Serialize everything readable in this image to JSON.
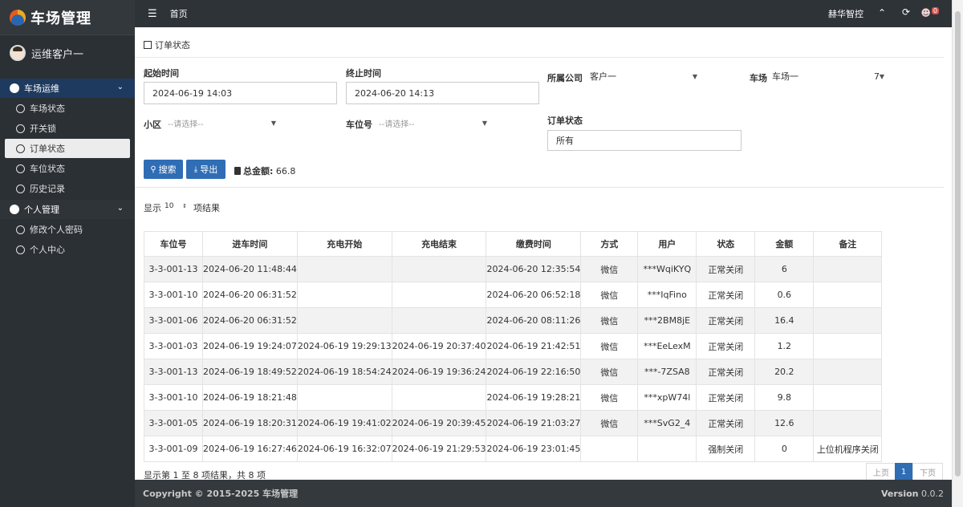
{
  "app": {
    "title": "车场管理"
  },
  "sidebar": {
    "user_name": "运维客户一",
    "groups": [
      {
        "label": "车场运维",
        "items": [
          "车场状态",
          "开关锁",
          "订单状态",
          "车位状态",
          "历史记录"
        ]
      },
      {
        "label": "个人管理",
        "items": [
          "修改个人密码",
          "个人中心"
        ]
      }
    ]
  },
  "topbar": {
    "menu_icon": "☰",
    "home": "首页",
    "brand": "赫华智控",
    "badge": "0"
  },
  "page": {
    "title": "订单状态"
  },
  "filters": {
    "start_label": "起始时间",
    "start_value": "2024-06-19 14:03",
    "end_label": "终止时间",
    "end_value": "2024-06-20 14:13",
    "company_label": "所属公司",
    "company_value": "客户一",
    "lot_label": "车场",
    "lot_value": "车场一",
    "lot_extra": "7",
    "district_label": "小区",
    "district_placeholder": "--请选择--",
    "space_label": "车位号",
    "space_placeholder": "--请选择--",
    "status_label": "订单状态",
    "status_value": "所有"
  },
  "actions": {
    "search": "搜索",
    "export": "导出",
    "total_label": "总金额:",
    "total_value": "66.8"
  },
  "table": {
    "show_label": "显示",
    "page_length": "10",
    "show_suffix": "项结果",
    "columns": [
      "车位号",
      "进车时间",
      "充电开始",
      "充电结束",
      "缴费时间",
      "方式",
      "用户",
      "状态",
      "金额",
      "备注"
    ],
    "rows": [
      [
        "3-3-001-13",
        "2024-06-20 11:48:44",
        "",
        "",
        "2024-06-20 12:35:54",
        "微信",
        "***WqiKYQ",
        "正常关闭",
        "6",
        ""
      ],
      [
        "3-3-001-10",
        "2024-06-20 06:31:52",
        "",
        "",
        "2024-06-20 06:52:18",
        "微信",
        "***IqFino",
        "正常关闭",
        "0.6",
        ""
      ],
      [
        "3-3-001-06",
        "2024-06-20 06:31:52",
        "",
        "",
        "2024-06-20 08:11:26",
        "微信",
        "***2BM8jE",
        "正常关闭",
        "16.4",
        ""
      ],
      [
        "3-3-001-03",
        "2024-06-19 19:24:07",
        "2024-06-19 19:29:13",
        "2024-06-19 20:37:40",
        "2024-06-19 21:42:51",
        "微信",
        "***EeLexM",
        "正常关闭",
        "1.2",
        ""
      ],
      [
        "3-3-001-13",
        "2024-06-19 18:49:52",
        "2024-06-19 18:54:24",
        "2024-06-19 19:36:24",
        "2024-06-19 22:16:50",
        "微信",
        "***-7ZSA8",
        "正常关闭",
        "20.2",
        ""
      ],
      [
        "3-3-001-10",
        "2024-06-19 18:21:48",
        "",
        "",
        "2024-06-19 19:28:21",
        "微信",
        "***xpW74l",
        "正常关闭",
        "9.8",
        ""
      ],
      [
        "3-3-001-05",
        "2024-06-19 18:20:31",
        "2024-06-19 19:41:02",
        "2024-06-19 20:39:45",
        "2024-06-19 21:03:27",
        "微信",
        "***SvG2_4",
        "正常关闭",
        "12.6",
        ""
      ],
      [
        "3-3-001-09",
        "2024-06-19 16:27:46",
        "2024-06-19 16:32:07",
        "2024-06-19 21:29:53",
        "2024-06-19 23:01:45",
        "",
        "",
        "强制关闭",
        "0",
        "上位机程序关闭"
      ]
    ],
    "info": "显示第 1 至 8 项结果，共 8 项",
    "prev": "上页",
    "page": "1",
    "next": "下页"
  },
  "footer": {
    "copyright": "Copyright © 2015-2025 车场管理",
    "version_label": "Version",
    "version": "0.0.2"
  }
}
